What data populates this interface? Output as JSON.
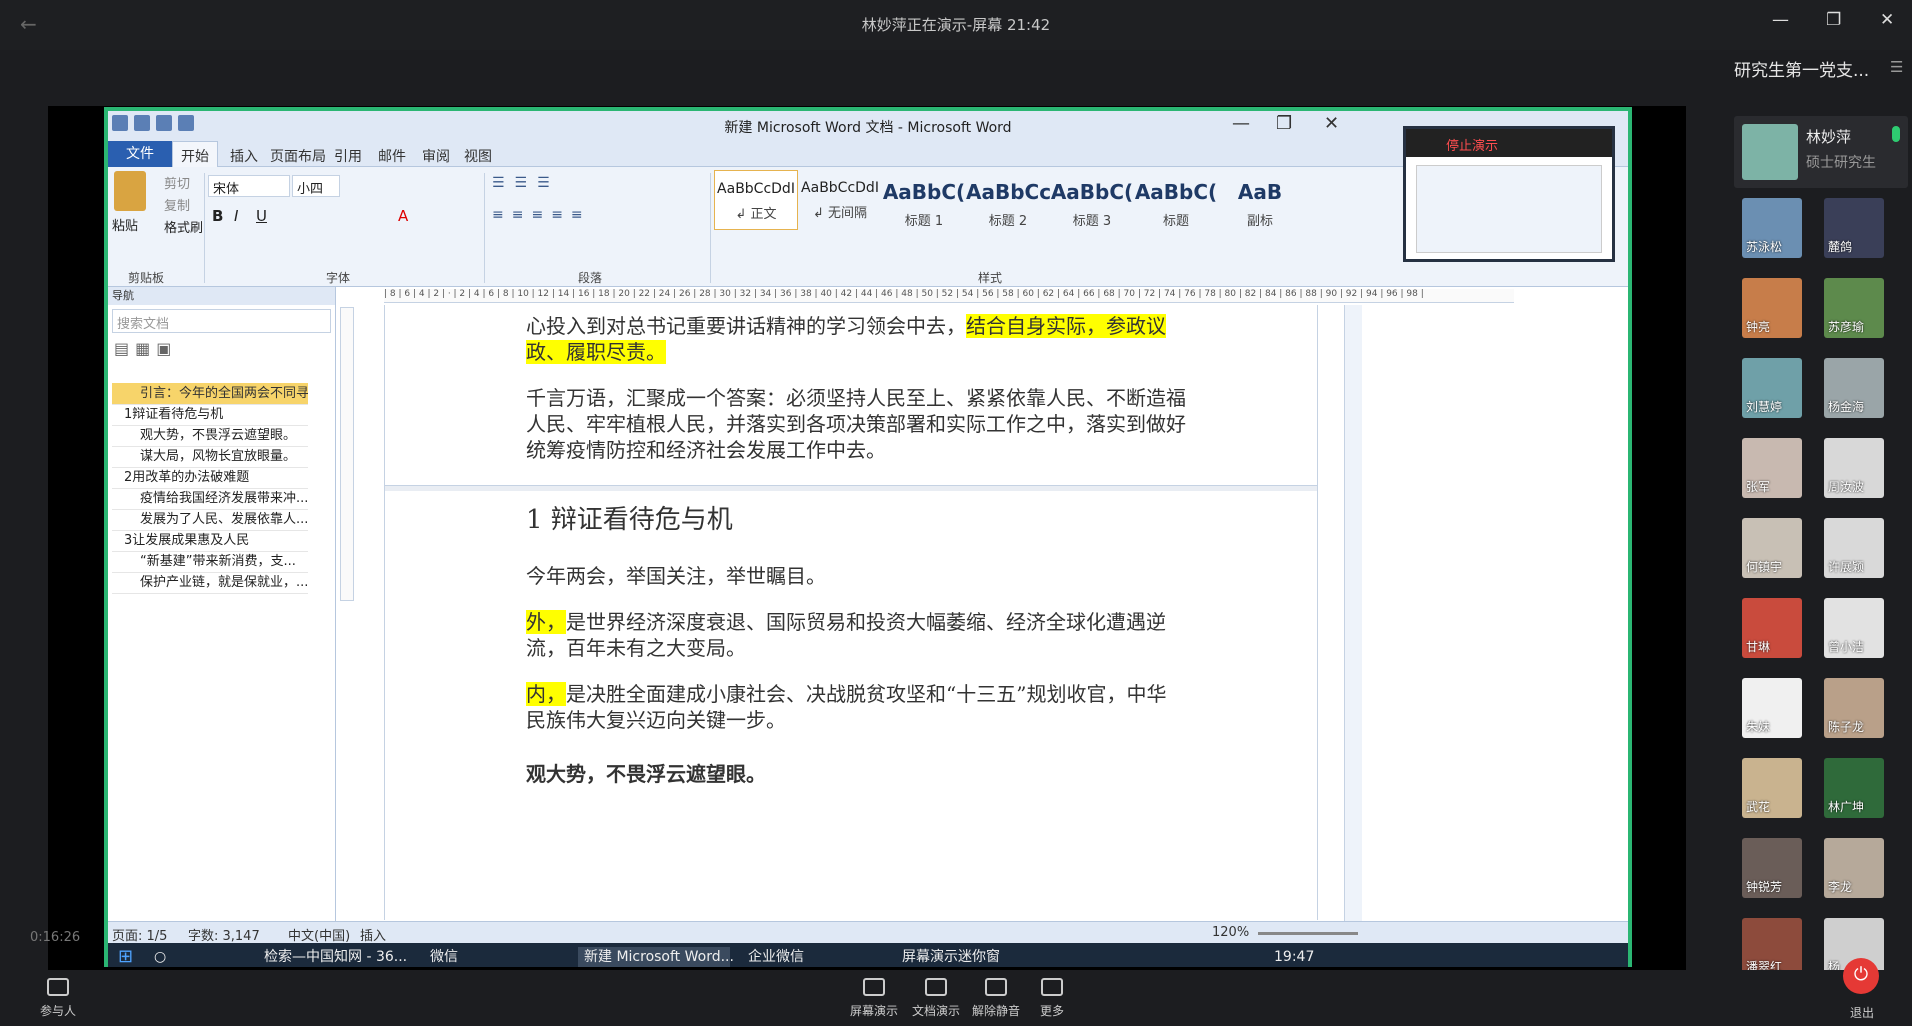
{
  "meeting": {
    "title": "林妙萍正在演示-屏幕 21:42",
    "elapsed": "0:16:26"
  },
  "panel": {
    "title": "研究生第一党支...",
    "me_name": "林妙萍",
    "me_role": "硕士研究生",
    "participants": [
      "苏泳松",
      "麓鸽",
      "钟亮",
      "苏彦瑜",
      "刘慧婷",
      "杨金海",
      "张军",
      "周汝波",
      "何镇宇",
      "许展颖",
      "甘琳",
      "曾小洁",
      "朱妹",
      "陈子龙",
      "武花",
      "林广坤",
      "钟锐芳",
      "李龙",
      "潘翠红",
      "杨"
    ],
    "colors": [
      "#6b8fb2",
      "#3a3f58",
      "#c77d4a",
      "#5d8a4c",
      "#6fa0a8",
      "#9aa5a8",
      "#c8b9b0",
      "#d8d8d8",
      "#c8c0b5",
      "#d9d9d9",
      "#c94b3d",
      "#e2e2e2",
      "#f0f0f0",
      "#b9a089",
      "#c9b38f",
      "#2f6a3a",
      "#6a5d58",
      "#b6a99a",
      "#8d4b3c",
      "#cfcfcf"
    ]
  },
  "word": {
    "title": "新建 Microsoft Word 文档 - Microsoft Word",
    "tabs": [
      "文件",
      "开始",
      "插入",
      "页面布局",
      "引用",
      "邮件",
      "审阅",
      "视图"
    ],
    "clipboard": {
      "paste": "粘贴",
      "cut": "剪切",
      "copy": "复制",
      "format": "格式刷",
      "group": "剪贴板"
    },
    "font": {
      "name": "宋体",
      "size": "小四",
      "group": "字体"
    },
    "paragraph_group": "段落",
    "styles_group": "样式",
    "styles": [
      {
        "sample": "AaBbCcDdI",
        "label": "↲ 正文"
      },
      {
        "sample": "AaBbCcDdI",
        "label": "↲ 无间隔"
      },
      {
        "sample": "AaBbC(",
        "label": "标题 1"
      },
      {
        "sample": "AaBbCcI",
        "label": "标题 2"
      },
      {
        "sample": "AaBbC(",
        "label": "标题 3"
      },
      {
        "sample": "AaBbC(",
        "label": "标题"
      },
      {
        "sample": "AaB",
        "label": "副标"
      }
    ],
    "nav": {
      "header": "导航",
      "search_placeholder": "搜索文档",
      "items": [
        {
          "text": "引言：今年的全国两会不同寻常...",
          "level": 1,
          "hl": true
        },
        {
          "text": "1辩证看待危与机",
          "level": 0
        },
        {
          "text": "观大势，不畏浮云遮望眼。",
          "level": 1
        },
        {
          "text": "谋大局，风物长宜放眼量。",
          "level": 1
        },
        {
          "text": "2用改革的办法破难题",
          "level": 0
        },
        {
          "text": "疫情给我国经济发展带来冲...",
          "level": 1
        },
        {
          "text": "发展为了人民、发展依靠人...",
          "level": 1
        },
        {
          "text": "3让发展成果惠及人民",
          "level": 0
        },
        {
          "text": "“新基建”带来新消费，支...",
          "level": 1
        },
        {
          "text": "保护产业链，就是保就业，...",
          "level": 1
        }
      ]
    },
    "doc": {
      "p1a": "心投入到对总书记重要讲话精神的学习领会中去，",
      "p1b": "结合自身实际，参政议政、履职尽责。",
      "p2": "千言万语，汇聚成一个答案：必须坚持人民至上、紧紧依靠人民、不断造福人民、牢牢植根人民，并落实到各项决策部署和实际工作之中，落实到做好统筹疫情防控和经济社会发展工作中去。",
      "heading": "1 辩证看待危与机",
      "p3": "今年两会，举国关注，举世瞩目。",
      "p4a": "外，",
      "p4b": "是世界经济深度衰退、国际贸易和投资大幅萎缩、经济全球化遭遇逆流，百年未有之大变局。",
      "p5a": "内，",
      "p5b": "是决胜全面建成小康社会、决战脱贫攻坚和“十三五”规划收官，中华民族伟大复兴迈向关键一步。",
      "p6": "观大势，不畏浮云遮望眼。"
    },
    "status": {
      "page": "页面: 1/5",
      "words": "字数: 3,147",
      "lang": "中文(中国)",
      "mode": "插入",
      "zoom": "120%"
    },
    "mini_stop": "停止演示"
  },
  "taskbar": {
    "items": [
      "检索—中国知网 - 36...",
      "微信",
      "新建 Microsoft Word...",
      "企业微信",
      "屏幕演示迷你窗"
    ],
    "time": "19:47"
  },
  "bottom": {
    "participants": "参与人",
    "share": "屏幕演示",
    "docs": "文档演示",
    "unmute": "解除静音",
    "more": "更多",
    "leave": "退出"
  }
}
